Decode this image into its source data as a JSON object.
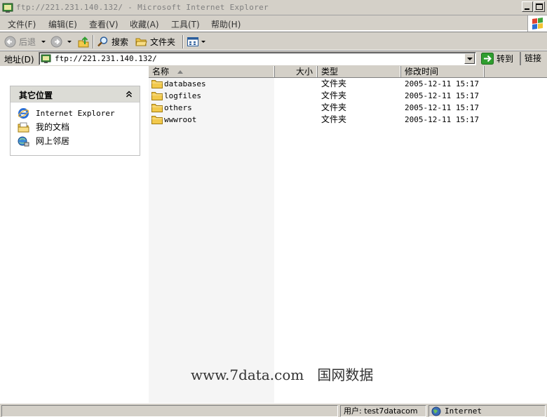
{
  "window": {
    "title": "ftp://221.231.140.132/ - Microsoft Internet Explorer"
  },
  "menu": [
    {
      "label": "文件(F)"
    },
    {
      "label": "编辑(E)"
    },
    {
      "label": "查看(V)"
    },
    {
      "label": "收藏(A)"
    },
    {
      "label": "工具(T)"
    },
    {
      "label": "帮助(H)"
    }
  ],
  "toolbar": {
    "back_label": "后退",
    "search_label": "搜索",
    "folders_label": "文件夹"
  },
  "address": {
    "label": "地址(D)",
    "value": "ftp://221.231.140.132/",
    "go_label": "转到",
    "links_label": "链接"
  },
  "other_places": {
    "title": "其它位置",
    "items": [
      {
        "label": "Internet Explorer",
        "icon": "ie-icon"
      },
      {
        "label": "我的文档",
        "icon": "my-documents-icon"
      },
      {
        "label": "网上邻居",
        "icon": "network-places-icon"
      }
    ]
  },
  "file_list": {
    "columns": {
      "name": "名称",
      "size": "大小",
      "type": "类型",
      "modified": "修改时间"
    },
    "rows": [
      {
        "name": "databases",
        "size": "",
        "type": "文件夹",
        "modified": "2005-12-11 15:17"
      },
      {
        "name": "logfiles",
        "size": "",
        "type": "文件夹",
        "modified": "2005-12-11 15:17"
      },
      {
        "name": "others",
        "size": "",
        "type": "文件夹",
        "modified": "2005-12-11 15:17"
      },
      {
        "name": "wwwroot",
        "size": "",
        "type": "文件夹",
        "modified": "2005-12-11 15:17"
      }
    ]
  },
  "watermark": "www.7data.com   国网数据",
  "status": {
    "main": "",
    "user": "用户: test7datacom",
    "zone": "Internet"
  },
  "colors": {
    "chrome": "#d4d0c8",
    "pane_header": "#dcdcd6",
    "folder": "#f2c94c",
    "go_arrow": "#2f9e2f"
  }
}
